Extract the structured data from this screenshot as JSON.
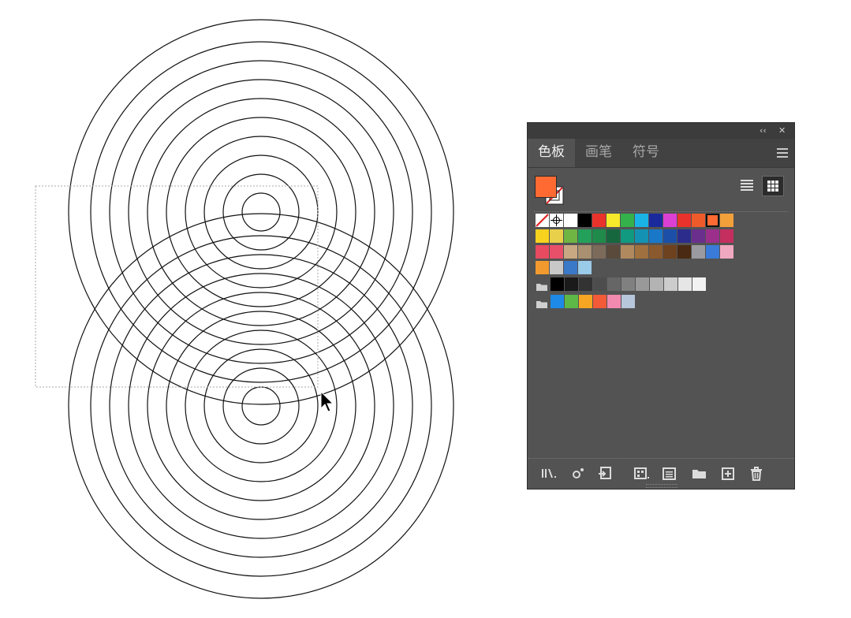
{
  "panel": {
    "tabs": [
      {
        "label": "色板",
        "active": true
      },
      {
        "label": "画笔",
        "active": false
      },
      {
        "label": "符号",
        "active": false
      }
    ],
    "collapse_glyph": "‹‹",
    "close_glyph": "✕",
    "fill_color": "#ff6a33"
  },
  "swatch_rows": [
    [
      "none",
      "registration",
      "#ffffff",
      "#000000",
      "#e8322b",
      "#f6e82a",
      "#34b14a",
      "#1ab3e6",
      "#1a2a9c",
      "#dc3fd4",
      "#e8322b",
      "#ee5a2a",
      "#ff6a33",
      "#f2a03a"
    ],
    [
      "#f7d21f",
      "#e9d04a",
      "#6fb544",
      "#23a05a",
      "#1f8a4a",
      "#17673e",
      "#129a80",
      "#1492b3",
      "#1a78c8",
      "#1c4fa8",
      "#2c2c8c",
      "#6a2f8c",
      "#9c2f8c",
      "#c42f5f"
    ],
    [
      "#e84a5f",
      "#e8506a",
      "#c8a882",
      "#a89070",
      "#7c6a5a",
      "#5a4a3c",
      "#b08a5e",
      "#a0703e",
      "#8a5a2e",
      "#6e421e",
      "#4a2a12",
      "#9a9aa0",
      "#3a7ad8",
      "#f0a8c0"
    ],
    [
      "#f29a2e",
      "#c8c8c8",
      "#3a78c8",
      "#9acbe8"
    ],
    [
      "folder",
      "#000000",
      "#1a1a1a",
      "#333333",
      "#4d4d4d",
      "#666666",
      "#808080",
      "#999999",
      "#b3b3b3",
      "#cccccc",
      "#e6e6e6",
      "#f2f2f2"
    ],
    [
      "folder",
      "#1d8ae8",
      "#5db848",
      "#f6a623",
      "#f25a38",
      "#f28ab0",
      "#b8c6dc"
    ]
  ],
  "selected_swatch": "#ff6a33",
  "icons": [
    "library-icon",
    "swatch-options-icon",
    "import-icon",
    "swatch-kind-icon",
    "swatch-options-list-icon",
    "new-group-icon",
    "new-swatch-icon",
    "delete-icon"
  ]
}
